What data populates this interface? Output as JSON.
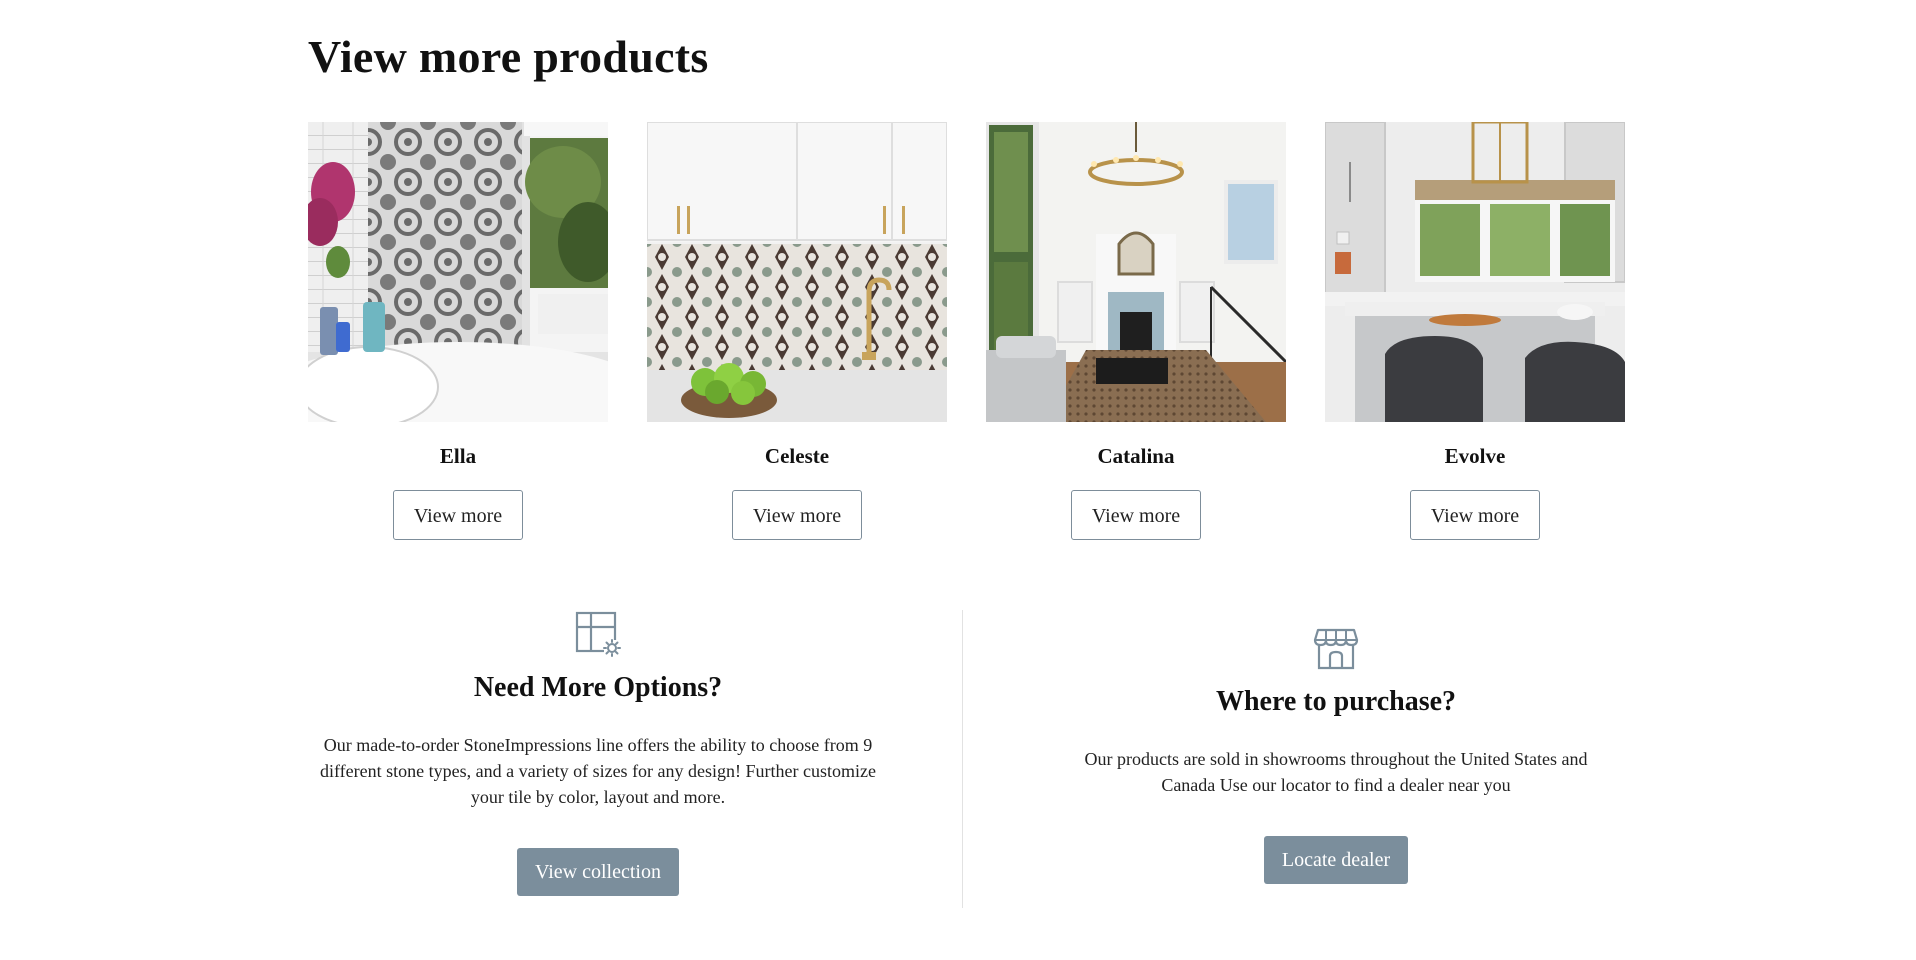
{
  "section": {
    "title": "View more products"
  },
  "products": [
    {
      "name": "Ella",
      "button_label": "View more"
    },
    {
      "name": "Celeste",
      "button_label": "View more"
    },
    {
      "name": "Catalina",
      "button_label": "View more"
    },
    {
      "name": "Evolve",
      "button_label": "View more"
    }
  ],
  "options": {
    "icon": "grid-settings-icon",
    "title": "Need More Options?",
    "text": "Our made-to-order StoneImpressions line offers the ability to choose from 9 different stone types, and a variety of sizes for any design! Further customize your tile by color, layout and more.",
    "button_label": "View collection"
  },
  "purchase": {
    "icon": "storefront-icon",
    "title": "Where to purchase?",
    "text": "Our products are sold in showrooms throughout the United States and Canada Use our locator to find a dealer near you",
    "button_label": "Locate dealer"
  },
  "colors": {
    "accent": "#7b8e9c",
    "border": "#7d8d9a",
    "divider": "#e2e2e2",
    "text": "#111111"
  }
}
